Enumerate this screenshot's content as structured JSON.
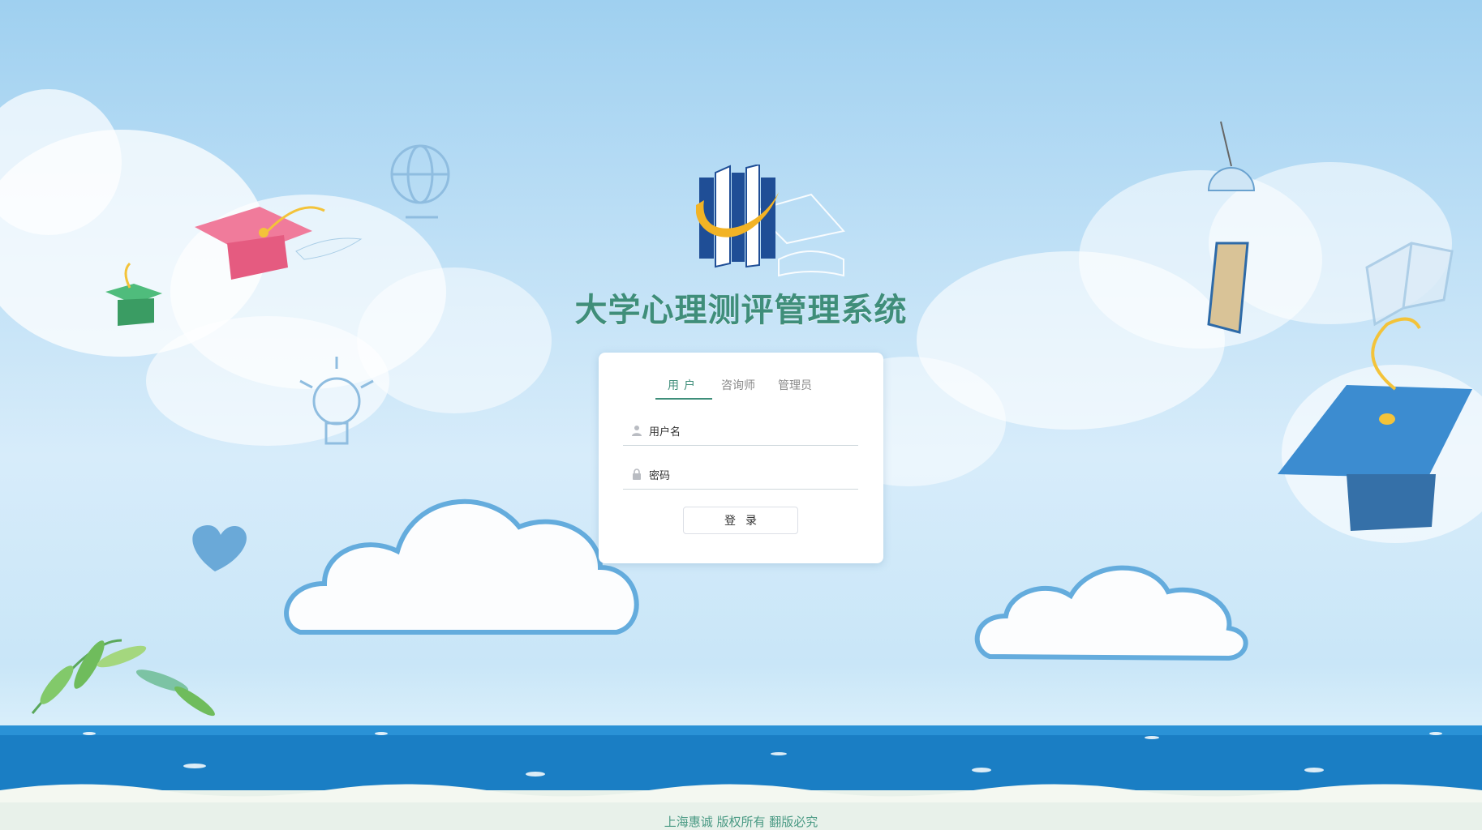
{
  "app": {
    "title": "大学心理测评管理系统"
  },
  "login": {
    "tabs": [
      {
        "label": "用户",
        "active": true
      },
      {
        "label": "咨询师",
        "active": false
      },
      {
        "label": "管理员",
        "active": false
      }
    ],
    "username_placeholder": "用户名",
    "password_placeholder": "密码",
    "submit_label": "登录",
    "icons": {
      "username": "user-icon",
      "password": "lock-icon"
    }
  },
  "footer": {
    "copyright": "上海惠诚 版权所有 翻版必究"
  },
  "colors": {
    "accent": "#3f8e7a",
    "sky": "#bfe0f6",
    "sea": "#1a7ec4",
    "logo_blue": "#1f4e96",
    "logo_gold": "#f2b325"
  }
}
